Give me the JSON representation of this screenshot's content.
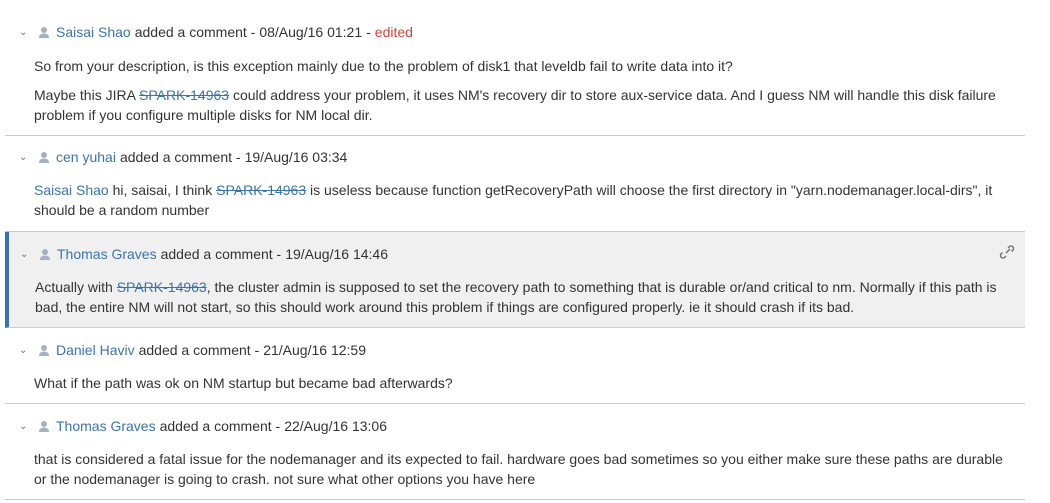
{
  "comments": [
    {
      "author": "Saisai Shao",
      "action": "added a comment -",
      "date": "08/Aug/16 01:21",
      "sep": "-",
      "edited": "edited",
      "p1": "So from your description, is this exception mainly due to the problem of disk1 that leveldb fail to write data into it?",
      "p2_pre": "Maybe this JIRA ",
      "p2_link": "SPARK-14963",
      "p2_post": " could address your problem, it uses NM's recovery dir to store aux-service data. And I guess NM will handle this disk failure problem if you configure multiple disks for NM local dir."
    },
    {
      "author": "cen yuhai",
      "action": "added a comment -",
      "date": "19/Aug/16 03:34",
      "user_link": "Saisai Shao",
      "text_a": " hi, saisai, I think ",
      "issue_link": "SPARK-14963",
      "text_b": " is useless because function getRecoveryPath will choose the first directory in \"yarn.nodemanager.local-dirs\", it should be a random number"
    },
    {
      "author": "Thomas Graves",
      "action": "added a comment -",
      "date": "19/Aug/16 14:46",
      "text_a": "Actually with ",
      "issue_link": "SPARK-14963",
      "text_b": ", the cluster admin is supposed to set the recovery path to something that is durable or/and critical to nm. Normally if this path is bad, the entire NM will not start, so this should work around this problem if things are configured properly. ie it should crash if its bad."
    },
    {
      "author": "Daniel Haviv",
      "action": "added a comment -",
      "date": "21/Aug/16 12:59",
      "text": "What if the path was ok on NM startup but became bad afterwards?"
    },
    {
      "author": "Thomas Graves",
      "action": "added a comment -",
      "date": "22/Aug/16 13:06",
      "text": "that is considered a fatal issue for the nodemanager and its expected to fail. hardware goes bad sometimes so you either make sure these paths are durable or the nodemanager is going to crash. not sure what other options you have here"
    }
  ],
  "icons": {
    "collapse": "chevron-down-icon",
    "avatar": "user-avatar-icon",
    "permalink": "link-icon"
  },
  "colors": {
    "link": "#3b73af",
    "edited": "#d04437",
    "focus_bar": "#3b73af",
    "focus_bg": "#f0f0f0"
  }
}
